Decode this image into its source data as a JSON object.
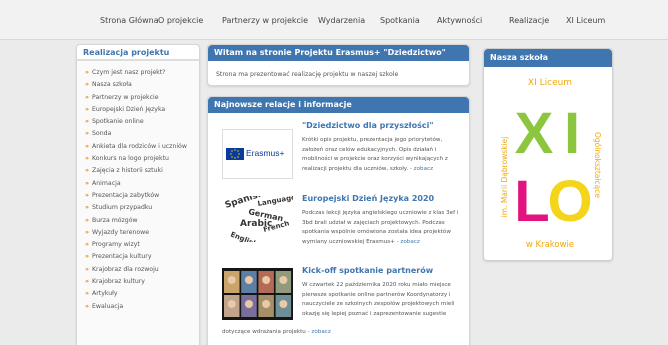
{
  "nav": {
    "items": [
      "Strona Główna",
      "O projekcie",
      "Partnerzy w projekcie",
      "Wydarzenia",
      "Spotkania",
      "Aktywności",
      "Realizacje",
      "XI Liceum"
    ]
  },
  "left_sidebar": {
    "title": "Realizacja projektu",
    "items": [
      "Czym jest nasz projekt?",
      "Nasza szkoła",
      "Partnerzy w projekcie",
      "Europejski Dzień Języka",
      "Spotkanie online",
      "Sonda",
      "Ankieta dla rodziców i uczniów",
      "Konkurs na logo projektu",
      "Zajęcia z historii sztuki",
      "Animacja",
      "Prezentacja zabytków",
      "Studium przypadku",
      "Burza mózgów",
      "Wyjazdy terenowe",
      "Programy wizyt",
      "Prezentacja kultury",
      "Krajobraz dla rozwoju",
      "Krajobraz kultury",
      "Artykuły",
      "Ewaluacja"
    ],
    "arrow": "»"
  },
  "welcome": {
    "title": "Witam na stronie Projektu Erasmus+ \"Dziedzictwo\"",
    "text": "Strona ma prezentować realizację projektu w naszej szkole"
  },
  "news": {
    "title": "Najnowsze relacje i informacje",
    "items": [
      {
        "title": "\"Dziedzictwo dla przyszłości\"",
        "body": "Krótki opis projektu, prezentacja jego priorytetów, założeń oraz celów edukacyjnych. Opis działań i mobilności w projekcie oraz korzyści wynikających z realizacji projektu dla uczniów, szkoły.",
        "more": "- zobacz",
        "thumb_text": "Erasmus+"
      },
      {
        "title": "Europejski Dzień Języka 2020",
        "body": "Podczas lekcji języka angielskiego uczniowie z klas 3ef i 3bd brali udział w zajęciach projektowych. Podczas spotkania wspólnie omówiona została idea projektów wymiany uczniowskiej Erasmus+",
        "more": "- zobacz",
        "thumb_words": [
          "Spanish",
          "German",
          "Arabic",
          "Language",
          "English",
          "French"
        ]
      },
      {
        "title": "Kick-off spotkanie partnerów",
        "body": "W czwartek 22 października 2020 roku miało miejsce pierwsze spotkanie online partnerów Koordynatorzy i nauczyciele ze szkolnych zespołów projektowych mieli okazję się lepiej poznać i zaprezentowanie sugestie",
        "tail": "dotyczące wdrażania projektu",
        "more": "- zobacz"
      }
    ]
  },
  "school": {
    "title": "Nasza szkoła",
    "logo": {
      "top_text": "XI Liceum",
      "left_text": "im. Marii Dąbrowskiej",
      "right_text": "Ogólnokształcące",
      "bottom_text": "w Krakowie",
      "letters": [
        "X",
        "I",
        "L",
        "O"
      ]
    }
  },
  "colors": {
    "accent": "#3f76b0",
    "arrow": "#e48a1a",
    "logo_green": "#8cc63f",
    "logo_pink": "#e2137e",
    "logo_yellow": "#f4d51c",
    "logo_text": "#f0a80a"
  }
}
